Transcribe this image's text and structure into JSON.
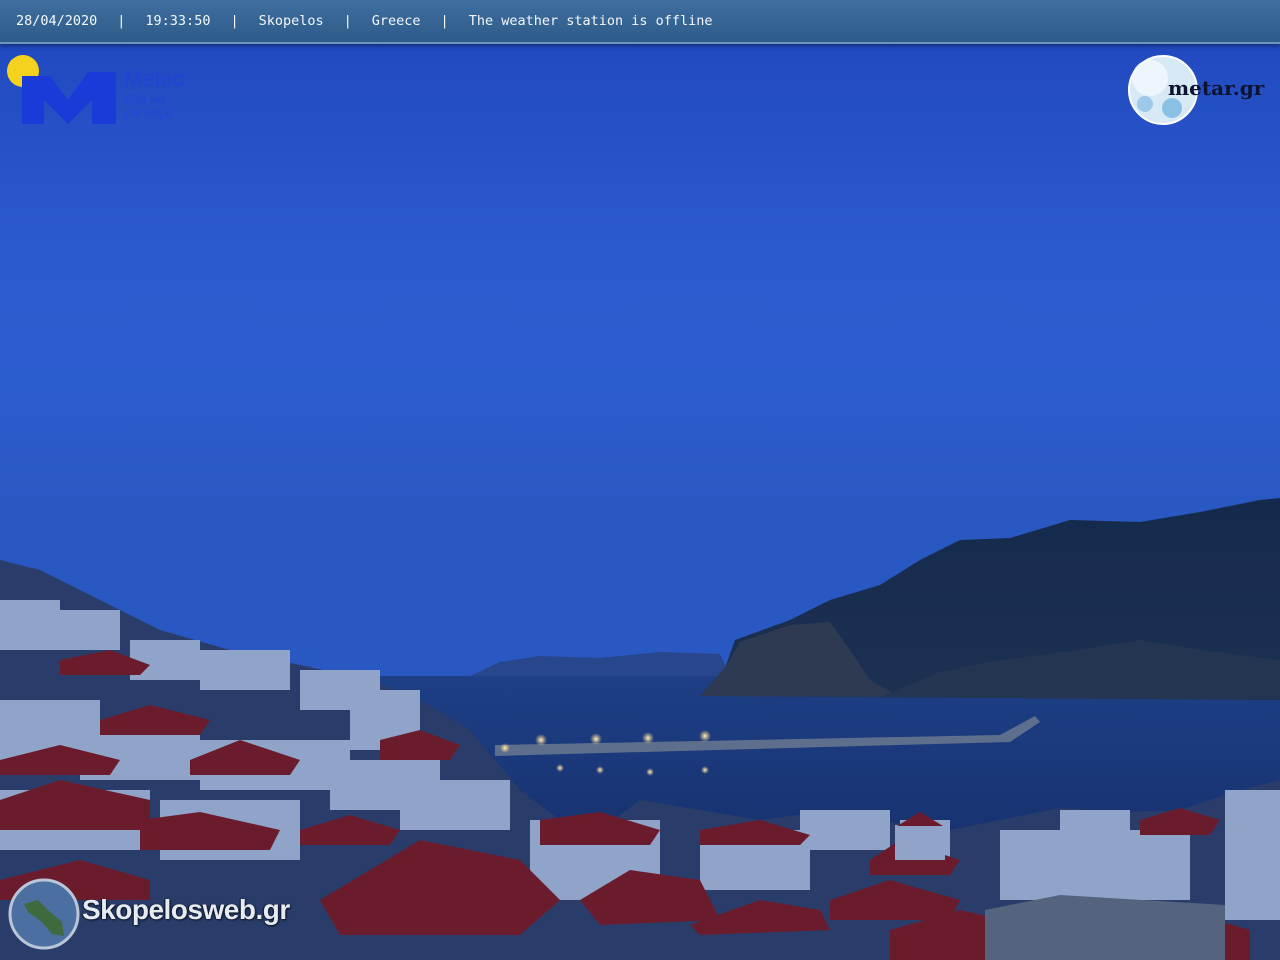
{
  "topbar": {
    "date": "28/04/2020",
    "time": "19:33:50",
    "location": "Skopelos",
    "country": "Greece",
    "status": "The weather station is offline",
    "separator": "|"
  },
  "logos": {
    "meteo_name": "Meteo",
    "meteo_tagline_1": "Όλα για",
    "meteo_tagline_2": "τον καιρό",
    "metar": "metar.gr",
    "skopelosweb": "Skopelosweb.gr"
  },
  "colors": {
    "sky_top": "#1f45b8",
    "sky_mid": "#2f5ed0",
    "meteo_blue": "#1f3fd0",
    "sun_yellow": "#f5d21e",
    "roof_red": "#7a1e2a"
  }
}
